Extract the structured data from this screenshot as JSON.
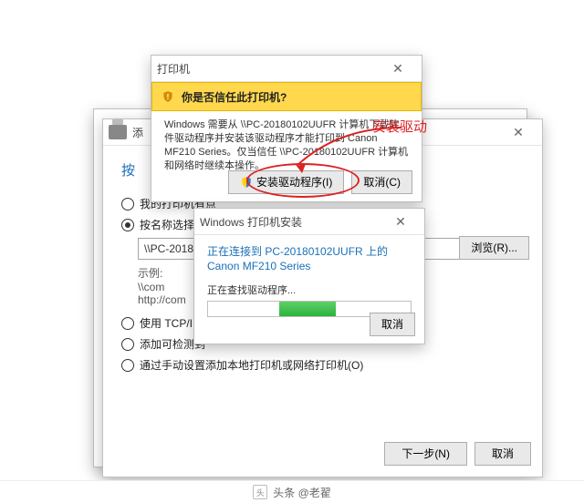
{
  "attribution": "头条 @老翟",
  "annotation": {
    "label": "安装驱动"
  },
  "wizard_back": {
    "title": "添",
    "heading": "按",
    "radios": {
      "r1": "我的打印机有点",
      "r2": "按名称选择共享",
      "r3": "使用 TCP/IP 地",
      "r4": "添加可检测到",
      "r5": "通过手动设置添加本地打印机或网络打印机(O)"
    },
    "path_value": "\\\\PC-2018",
    "example_label": "示例:",
    "example_line1": "\\\\com",
    "example_line2": "http://com",
    "browse": "浏览(R)...",
    "next": "下一步(N)",
    "cancel": "取消"
  },
  "trust_dialog": {
    "title": "打印机",
    "question": "你是否信任此打印机?",
    "body": "Windows 需要从 \\\\PC-20180102UUFR 计算机下载软件驱动程序并安装该驱动程序才能打印到 Canon MF210 Series。仅当信任 \\\\PC-20180102UUFR 计算机和网络时继续本操作。",
    "install": "安装驱动程序(I)",
    "cancel": "取消(C)"
  },
  "progress_dialog": {
    "title": "Windows 打印机安装",
    "connecting": "正在连接到 PC-20180102UUFR 上的 Canon MF210 Series",
    "finding": "正在查找驱动程序...",
    "cancel": "取消"
  }
}
